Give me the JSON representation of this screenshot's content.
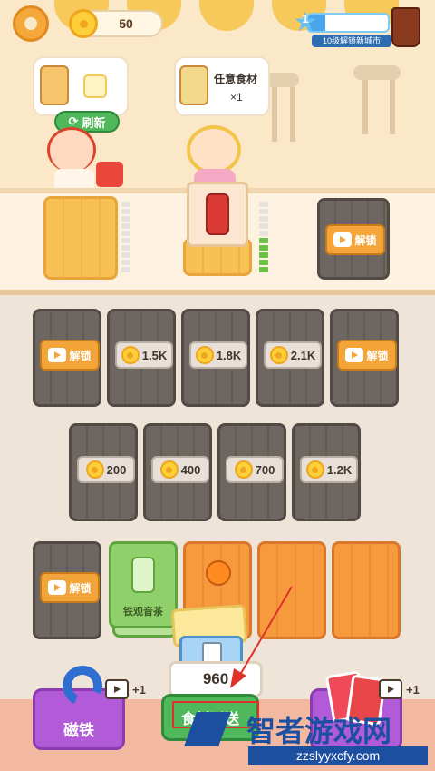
{
  "hud": {
    "coins": "50",
    "level": "1",
    "level_progress": 0.22,
    "level_text": "10级解锁新城市"
  },
  "orders": {
    "any_ingredient_label": "任意食材",
    "any_ingredient_count": "×1",
    "refresh_label": "刷新"
  },
  "counter": {
    "unlock_label": "解锁"
  },
  "grid": {
    "row1": [
      {
        "type": "locked-ad",
        "label": "解锁"
      },
      {
        "type": "price",
        "label": "1.5K"
      },
      {
        "type": "price",
        "label": "1.8K"
      },
      {
        "type": "price",
        "label": "2.1K"
      },
      {
        "type": "locked-ad",
        "label": "解锁"
      }
    ],
    "row2": [
      {
        "type": "price",
        "label": "200"
      },
      {
        "type": "price",
        "label": "400"
      },
      {
        "type": "price",
        "label": "700"
      },
      {
        "type": "price",
        "label": "1.2K"
      }
    ],
    "row3_unlock_label": "解锁",
    "tea_card_label": "铁观音茶"
  },
  "delivery": {
    "count": "960",
    "button_label": "食材派送"
  },
  "bottom": {
    "magnet_label": "磁铁",
    "magnet_bonus": "+1",
    "shuffle_bonus": "+1"
  },
  "watermark": {
    "title": "智者游戏网",
    "url": "zzslyyxcfy.com"
  },
  "colors": {
    "accent_orange": "#f3a53a",
    "locked_gray": "#6e6661",
    "green": "#4fb85b",
    "arrow_red": "#e0302a"
  }
}
